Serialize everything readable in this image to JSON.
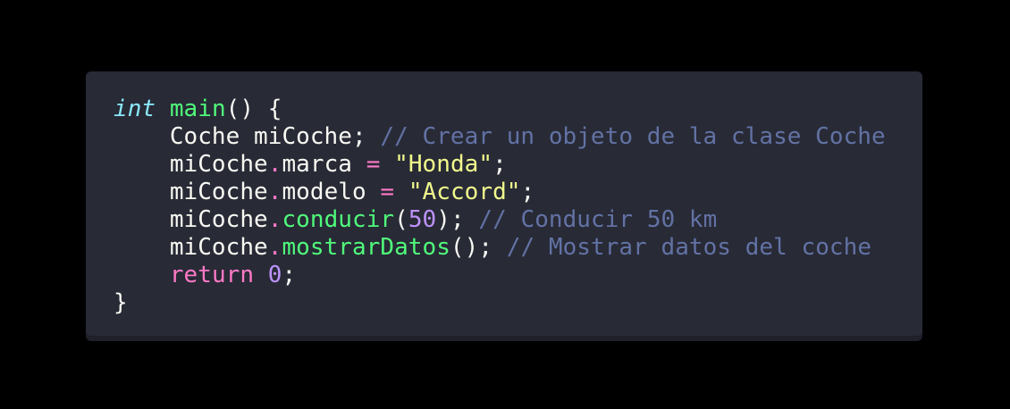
{
  "colors": {
    "background": "#000000",
    "editor": "#282a36",
    "text": "#f8f8f2",
    "type_keyword": "#8be9fd",
    "function": "#50fa7b",
    "operator": "#ff79c6",
    "string": "#f1fa8c",
    "number": "#bd93f9",
    "comment": "#6272a4"
  },
  "code": {
    "lines": [
      {
        "tokens": [
          {
            "type": "kw-type",
            "text": "int"
          },
          {
            "type": "plain",
            "text": " "
          },
          {
            "type": "fn",
            "text": "main"
          },
          {
            "type": "plain",
            "text": "() {"
          }
        ]
      },
      {
        "tokens": [
          {
            "type": "plain",
            "text": "    Coche miCoche; "
          },
          {
            "type": "cm",
            "text": "// Crear un objeto de la clase Coche"
          }
        ]
      },
      {
        "tokens": [
          {
            "type": "plain",
            "text": "    miCoche"
          },
          {
            "type": "op",
            "text": "."
          },
          {
            "type": "plain",
            "text": "marca "
          },
          {
            "type": "op",
            "text": "="
          },
          {
            "type": "plain",
            "text": " "
          },
          {
            "type": "str",
            "text": "\"Honda\""
          },
          {
            "type": "plain",
            "text": ";"
          }
        ]
      },
      {
        "tokens": [
          {
            "type": "plain",
            "text": "    miCoche"
          },
          {
            "type": "op",
            "text": "."
          },
          {
            "type": "plain",
            "text": "modelo "
          },
          {
            "type": "op",
            "text": "="
          },
          {
            "type": "plain",
            "text": " "
          },
          {
            "type": "str",
            "text": "\"Accord\""
          },
          {
            "type": "plain",
            "text": ";"
          }
        ]
      },
      {
        "tokens": [
          {
            "type": "plain",
            "text": "    miCoche"
          },
          {
            "type": "op",
            "text": "."
          },
          {
            "type": "fn",
            "text": "conducir"
          },
          {
            "type": "plain",
            "text": "("
          },
          {
            "type": "num",
            "text": "50"
          },
          {
            "type": "plain",
            "text": "); "
          },
          {
            "type": "cm",
            "text": "// Conducir 50 km"
          }
        ]
      },
      {
        "tokens": [
          {
            "type": "plain",
            "text": "    miCoche"
          },
          {
            "type": "op",
            "text": "."
          },
          {
            "type": "fn",
            "text": "mostrarDatos"
          },
          {
            "type": "plain",
            "text": "(); "
          },
          {
            "type": "cm",
            "text": "// Mostrar datos del coche"
          }
        ]
      },
      {
        "tokens": [
          {
            "type": "plain",
            "text": "    "
          },
          {
            "type": "op",
            "text": "return"
          },
          {
            "type": "plain",
            "text": " "
          },
          {
            "type": "num",
            "text": "0"
          },
          {
            "type": "plain",
            "text": ";"
          }
        ]
      },
      {
        "tokens": [
          {
            "type": "plain",
            "text": "}"
          }
        ]
      }
    ]
  }
}
